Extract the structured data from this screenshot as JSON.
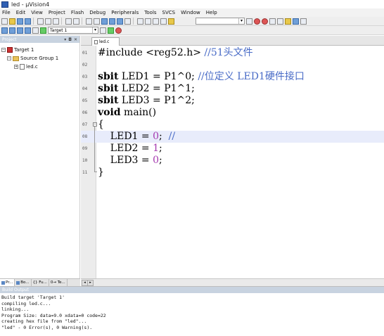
{
  "window": {
    "title": "led - µVision4"
  },
  "menu": [
    "File",
    "Edit",
    "View",
    "Project",
    "Flash",
    "Debug",
    "Peripherals",
    "Tools",
    "SVCS",
    "Window",
    "Help"
  ],
  "toolbar": {
    "target_select": "Target 1"
  },
  "project_panel": {
    "title": "Project",
    "tree": {
      "target": "Target 1",
      "group": "Source Group 1",
      "file": "led.c"
    },
    "tabs": [
      "Pr...",
      "Bo...",
      "{} Fu...",
      "0→ Te..."
    ]
  },
  "editor": {
    "tab_label": "led.c",
    "lines": [
      {
        "n": "01",
        "text": "#include <reg52.h> //51头文件"
      },
      {
        "n": "02",
        "text": ""
      },
      {
        "n": "03",
        "text": "sbit LED1 = P1^0; //位定义 LED1硬件接口"
      },
      {
        "n": "04",
        "text": "sbit LED2 = P1^1;"
      },
      {
        "n": "05",
        "text": "sbit LED3 = P1^2;"
      },
      {
        "n": "06",
        "text": "void main()"
      },
      {
        "n": "07",
        "text": "{"
      },
      {
        "n": "08",
        "text": "    LED1 = 0;  //"
      },
      {
        "n": "09",
        "text": "    LED2 = 1;"
      },
      {
        "n": "10",
        "text": "    LED3 = 0;"
      },
      {
        "n": "11",
        "text": "}"
      }
    ]
  },
  "build_output": {
    "title": "Build Output",
    "lines": [
      "Build target 'Target 1'",
      "compiling led.c...",
      "linking...",
      "Program Size: data=9.0 xdata=0 code=22",
      "creating hex file from \"led\"...",
      "\"led\" - 0 Error(s), 0 Warning(s)."
    ]
  },
  "colors": {
    "comment": "#4a6cc7",
    "number": "#a53ab0",
    "current_line": "#e8ecfb",
    "panel_header": "#c8d3e0"
  }
}
